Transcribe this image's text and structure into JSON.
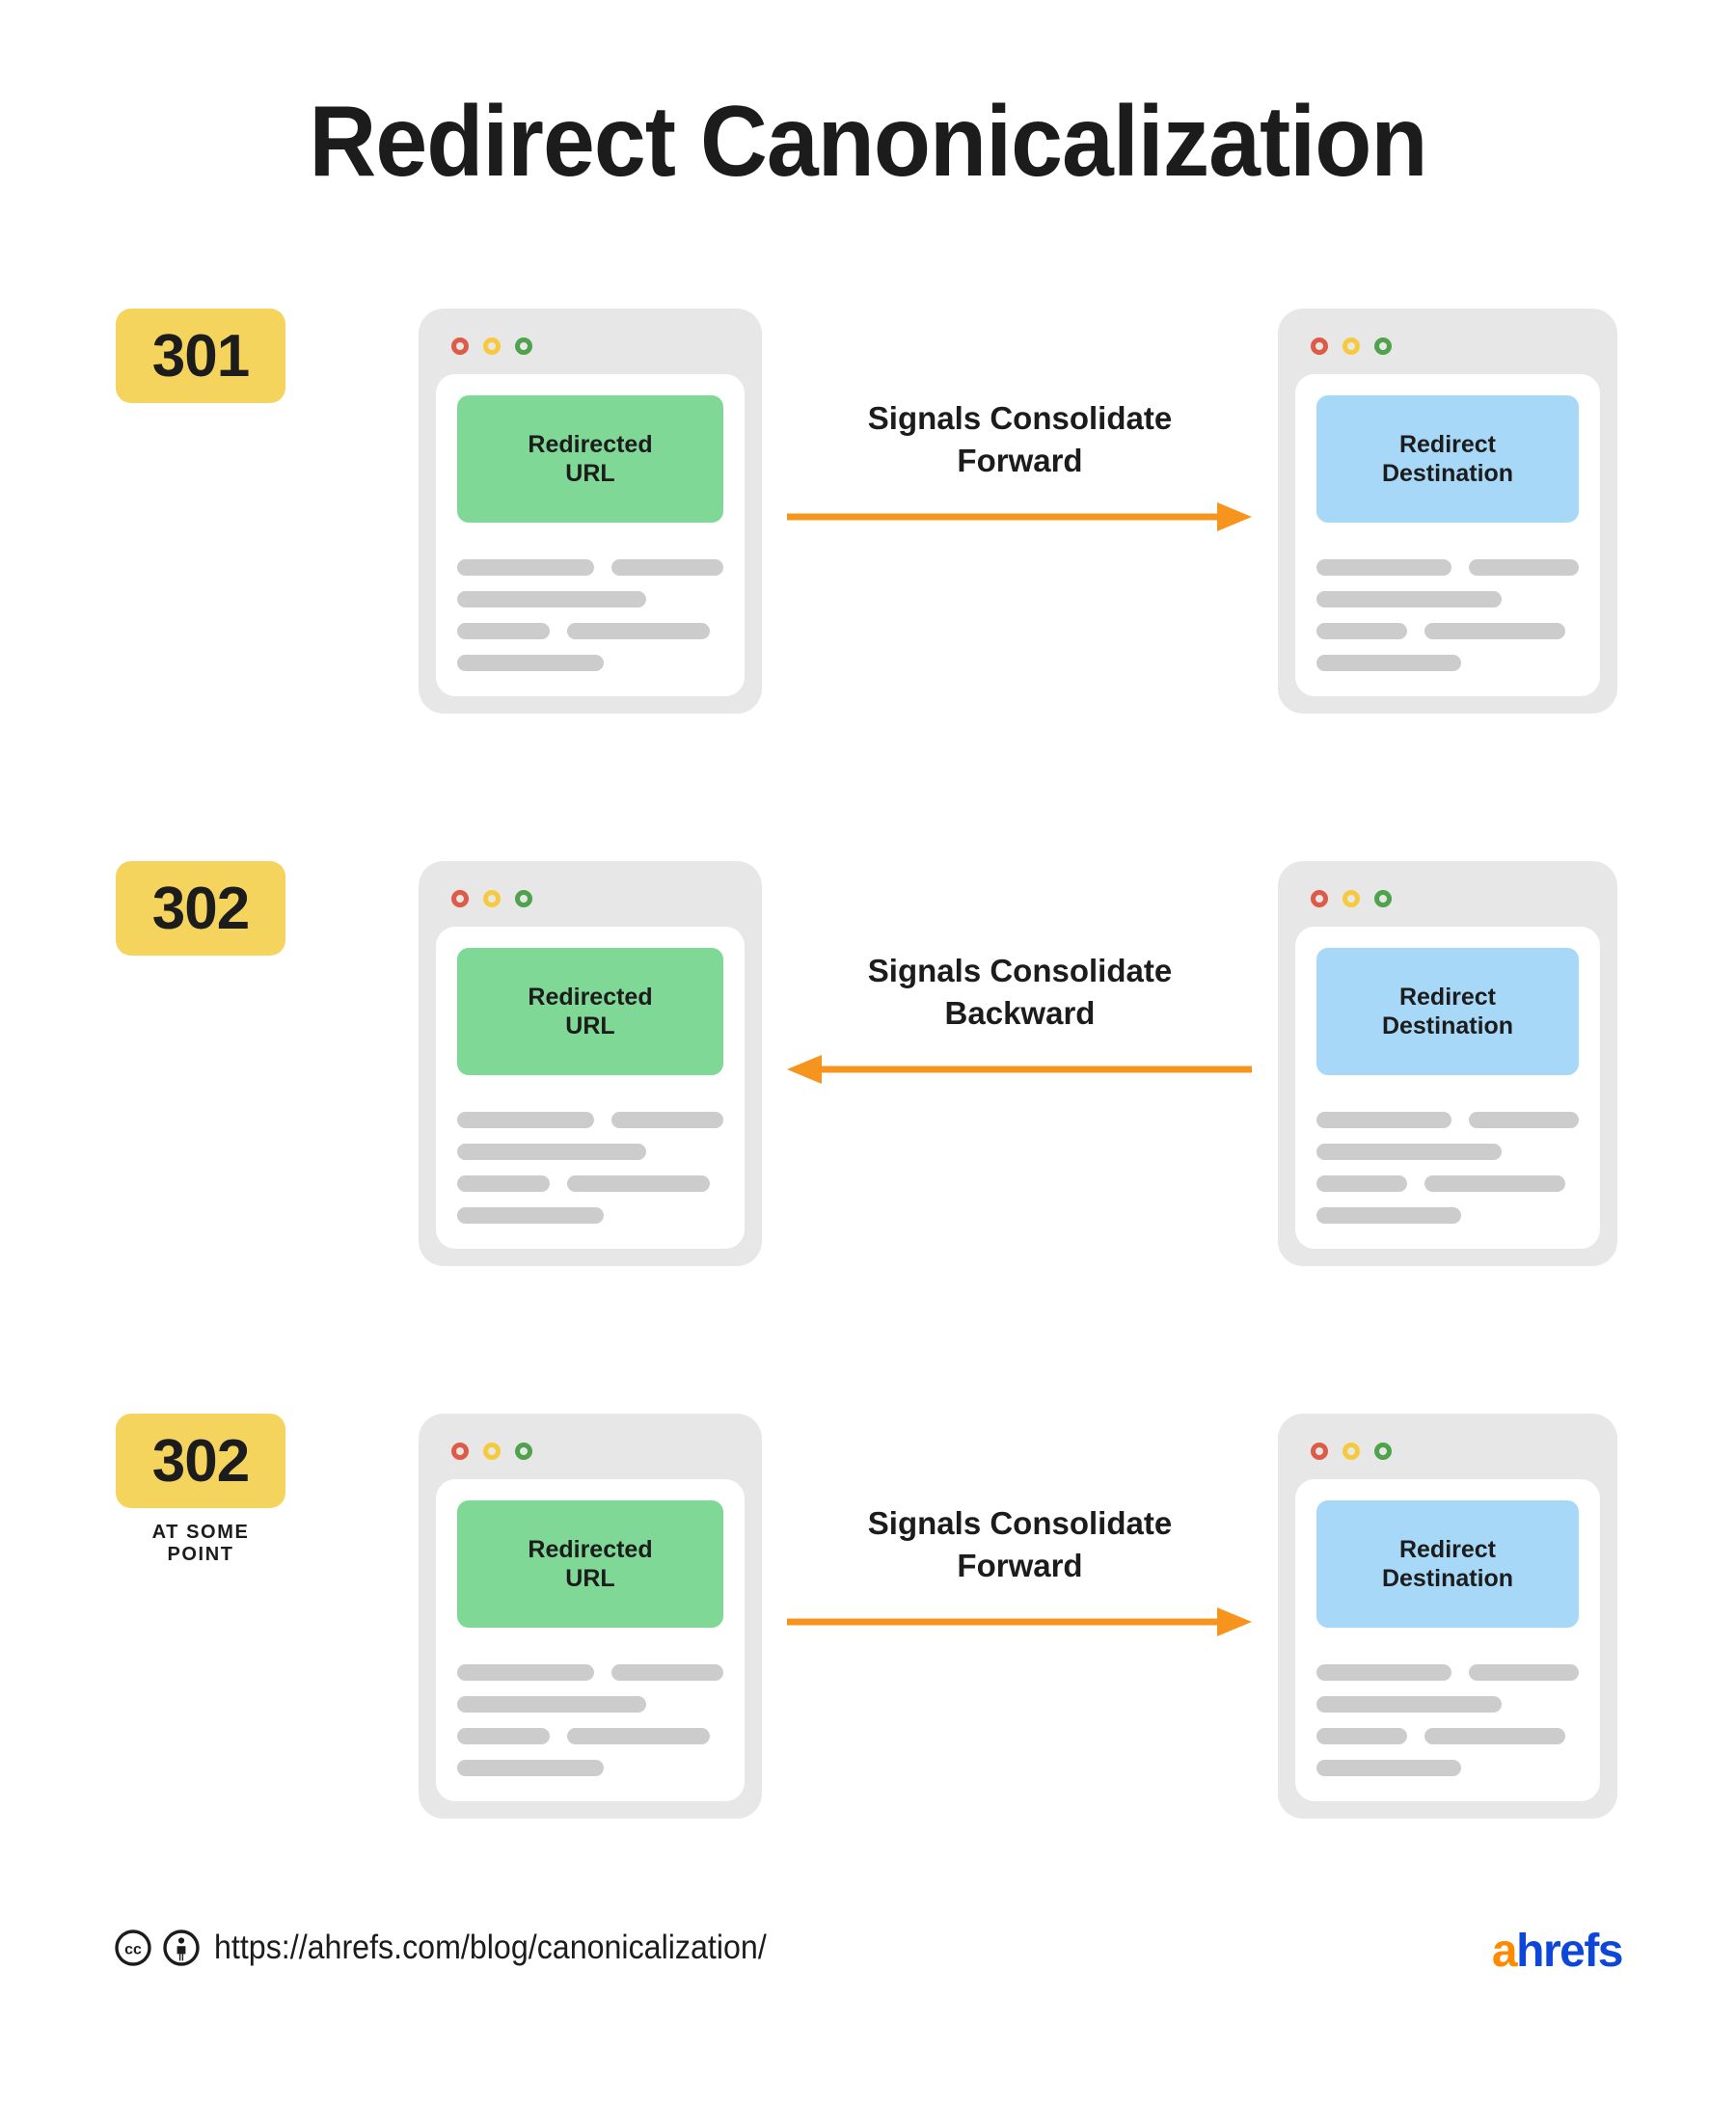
{
  "title": "Redirect Canonicalization",
  "colors": {
    "badge_bg": "#F5D45E",
    "source_block_bg": "#7FD895",
    "destination_block_bg": "#A7D8F7",
    "arrow": "#F7941D",
    "window_frame": "#E7E7E7",
    "placeholder_bar": "#CCCCCC",
    "text": "#1c1c1c",
    "logo_a": "#FF8A00",
    "logo_hrefs": "#0D47DA",
    "dot_red": "#DE5B47",
    "dot_yellow": "#F7C93E",
    "dot_green": "#4FA34C"
  },
  "rows": [
    {
      "badge": "301",
      "badge_sub": "",
      "source_label": "Redirected URL",
      "destination_label": "Redirect Destination",
      "arrow_label": "Signals Consolidate Forward",
      "arrow_direction": "right"
    },
    {
      "badge": "302",
      "badge_sub": "",
      "source_label": "Redirected URL",
      "destination_label": "Redirect Destination",
      "arrow_label": "Signals Consolidate Backward",
      "arrow_direction": "left"
    },
    {
      "badge": "302",
      "badge_sub": "AT SOME POINT",
      "source_label": "Redirected URL",
      "destination_label": "Redirect Destination",
      "arrow_label": "Signals Consolidate Forward",
      "arrow_direction": "right"
    }
  ],
  "footer": {
    "license_icons": [
      "cc-icon",
      "cc-by-icon"
    ],
    "url": "https://ahrefs.com/blog/canonicalization/",
    "logo_first": "a",
    "logo_rest": "hrefs"
  }
}
